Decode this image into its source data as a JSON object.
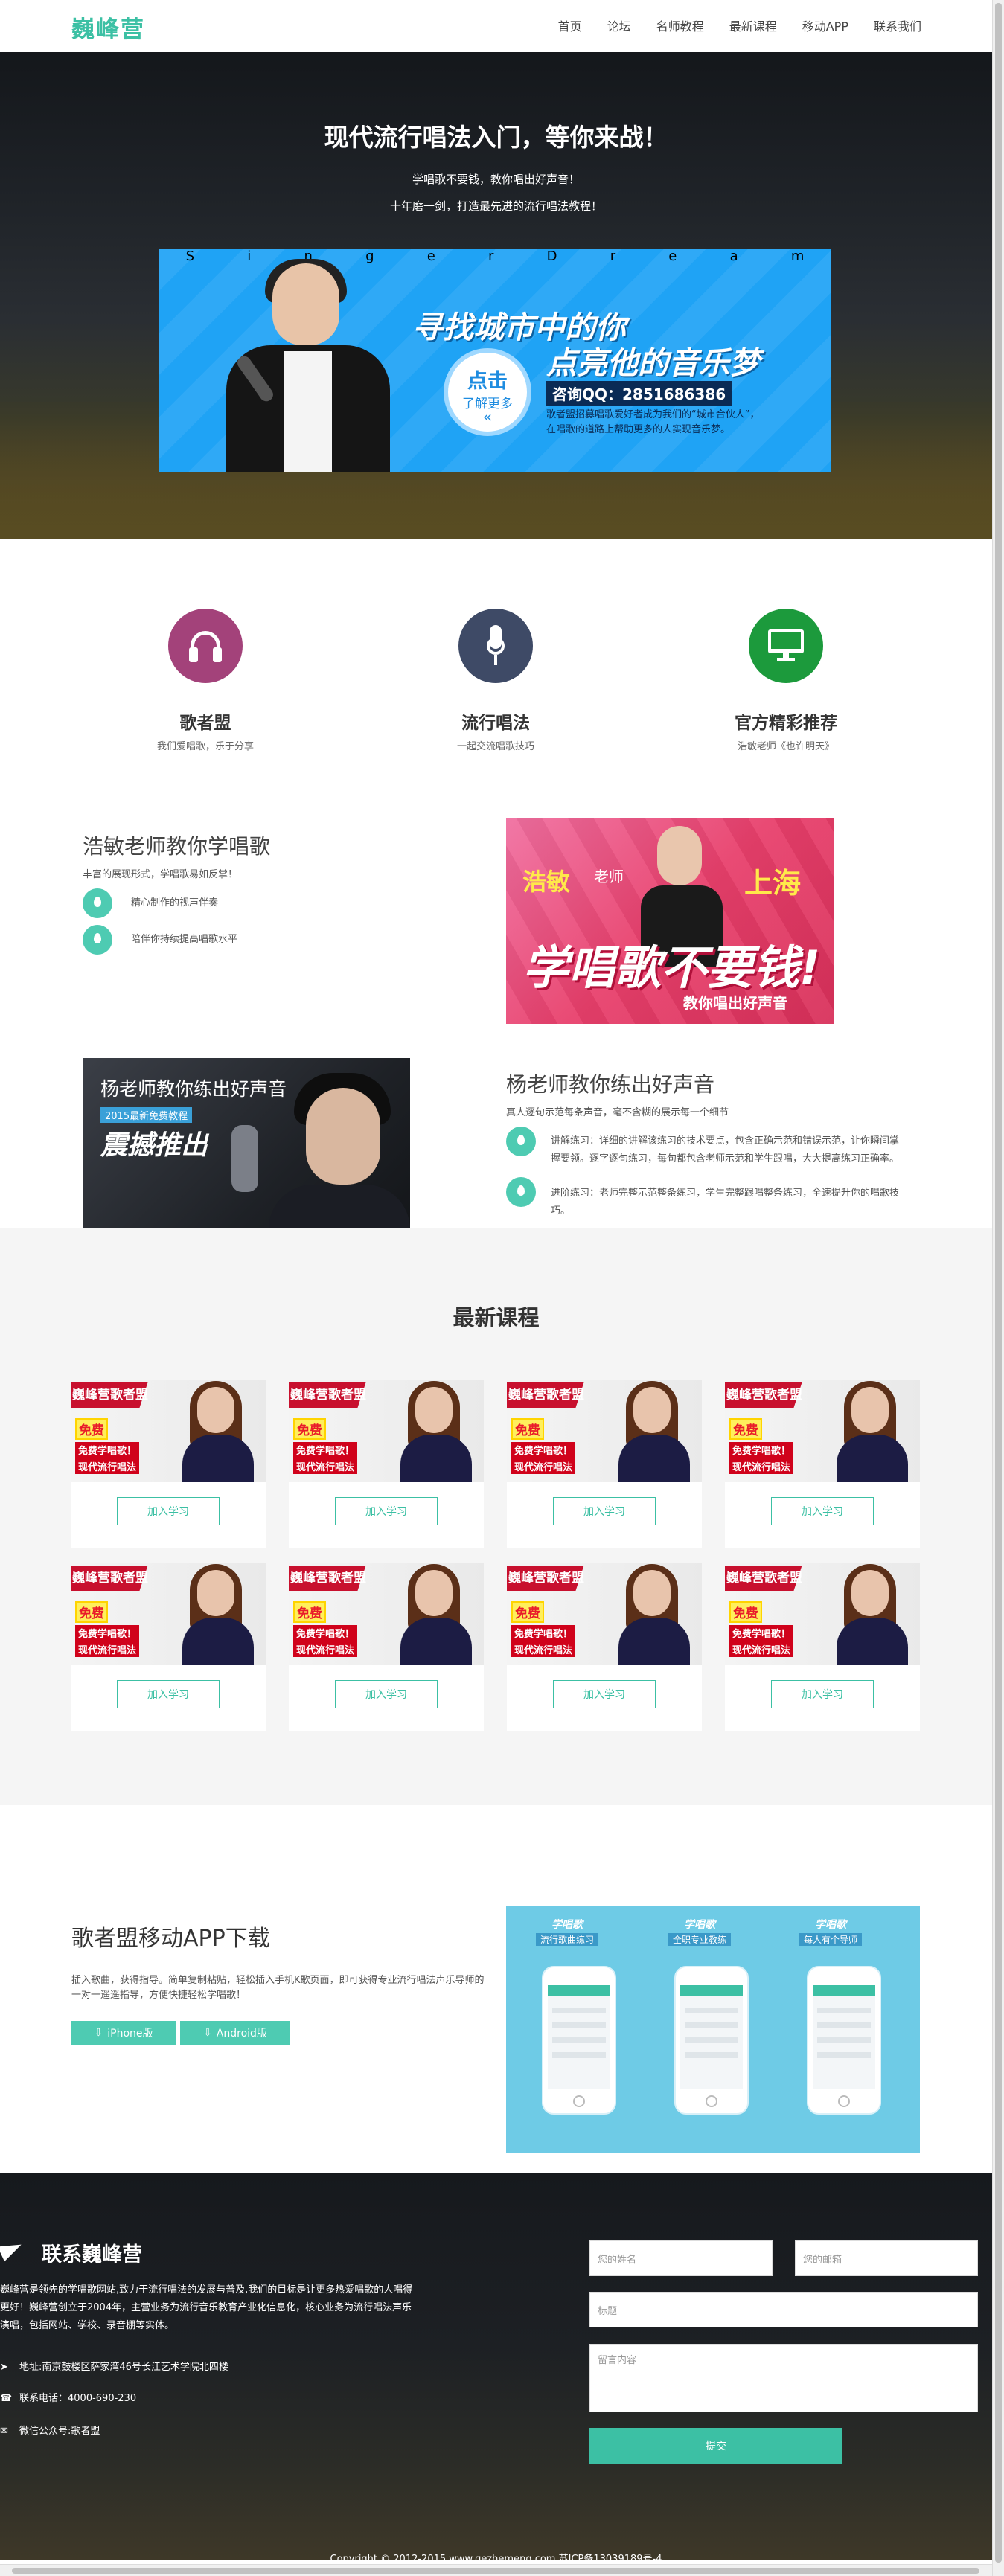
{
  "header": {
    "logo": "巍峰营",
    "nav": [
      "首页",
      "论坛",
      "名师教程",
      "最新课程",
      "移动APP",
      "联系我们"
    ]
  },
  "hero": {
    "title": "现代流行唱法入门，等你来战！",
    "sub1": "学唱歌不要钱，教你唱出好声音！",
    "sub2": "十年磨一剑，打造最先进的流行唱法教程！",
    "banner": {
      "letters": [
        "S",
        "i",
        "n",
        "g",
        "e",
        "r",
        "D",
        "r",
        "e",
        "a",
        "m"
      ],
      "slogan1": "寻找城市中的你",
      "slogan2": "点亮他的音乐梦",
      "badge_line1": "点击",
      "badge_line2": "了解更多",
      "badge_arrow": "«",
      "qq": "咨询QQ：2851686386",
      "desc1": "歌者盟招募唱歌爱好者成为我们的“城市合伙人”，",
      "desc2": "在唱歌的道路上帮助更多的人实现音乐梦。"
    }
  },
  "features": [
    {
      "title": "歌者盟",
      "desc": "我们爱唱歌，乐于分享",
      "color": "#a3427a",
      "icon": "headphones-icon"
    },
    {
      "title": "流行唱法",
      "desc": "一起交流唱歌技巧",
      "color": "#3e4a66",
      "icon": "microphone-icon"
    },
    {
      "title": "官方精彩推荐",
      "desc": "浩敏老师《也许明天》",
      "color": "#1c9a3c",
      "icon": "monitor-icon"
    }
  ],
  "teacher1": {
    "title": "浩敏老师教你学唱歌",
    "desc": "丰富的展现形式，学唱歌易如反掌！",
    "points": [
      "精心制作的视声伴奏",
      "陪伴你持续提高唱歌水平"
    ],
    "ad": {
      "name": "浩敏",
      "label": "老师",
      "city": "上海",
      "big": "学唱歌不要钱!",
      "sub": "教你唱出好声音"
    }
  },
  "teacher2": {
    "title": "杨老师教你练出好声音",
    "desc": "真人逐句示范每条声音，毫不含糊的展示每一个细节",
    "points": [
      "讲解练习：详细的讲解该练习的技术要点，包含正确示范和错误示范，让你瞬间掌握要领。逐字逐句练习，每句都包含老师示范和学生跟唱，大大提高练习正确率。",
      "进阶练习：老师完整示范整条练习，学生完整跟唱整条练习，全速提升你的唱歌技巧。"
    ],
    "ad": {
      "title": "杨老师教你练出好声音",
      "tag": "2015最新免费教程",
      "big": "震撼推出"
    }
  },
  "courses": {
    "title": "最新课程",
    "card": {
      "brand": "巍峰营歌者盟",
      "free": "免费",
      "line1": "免费学唱歌！",
      "line2": "现代流行唱法",
      "button": "加入学习"
    },
    "count": 8
  },
  "app": {
    "title": "歌者盟移动APP下载",
    "desc": "插入歌曲，获得指导。简单复制粘贴，轻松插入手机K歌页面，即可获得专业流行唱法声乐导师的一对一遥遥指导，方便快捷轻松学唱歌！",
    "ios": "iPhone版",
    "android": "Android版",
    "tags": [
      {
        "a": "学唱歌",
        "b": "流行歌曲练习"
      },
      {
        "a": "学唱歌",
        "b": "全职专业教练"
      },
      {
        "a": "学唱歌",
        "b": "每人有个导师"
      }
    ]
  },
  "footer": {
    "title": "联系巍峰营",
    "about": "巍峰营是领先的学唱歌网站,致力于流行唱法的发展与普及,我们的目标是让更多热爱唱歌的人唱得更好！巍峰营创立于2004年，主营业务为流行音乐教育产业化信息化，核心业务为流行唱法声乐演唱，包括网站、学校、录音棚等实体。",
    "address": "地址:南京鼓楼区萨家湾46号长江艺术学院北四楼",
    "phone": "联系电话：4000-690-230",
    "wechat": "微信公众号:歌者盟",
    "form": {
      "name_ph": "您的姓名",
      "email_ph": "您的邮箱",
      "subject_ph": "标题",
      "message_ph": "留言内容",
      "submit": "提交"
    },
    "copyright": "Copyright © 2012-2015  www.gezhemeng.com  苏ICP备13039189号-4"
  },
  "colors": {
    "accent": "#3cc0a4",
    "drop": "#4ecbb2"
  }
}
